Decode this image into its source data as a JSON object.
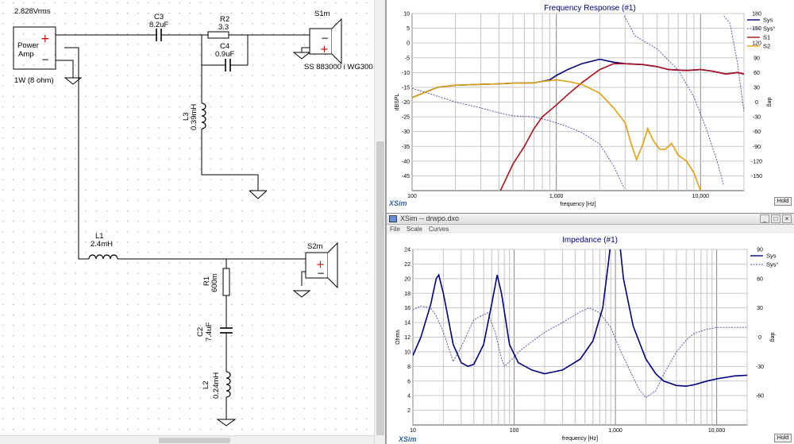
{
  "schematic": {
    "source_voltage": "2.828Vrms",
    "amp_label_line1": "Power",
    "amp_label_line2": "Amp",
    "amp_plus": "+",
    "amp_minus": "−",
    "amp_rating": "1W (8 ohm)",
    "c3_name": "C3",
    "c3_value": "8.2uF",
    "r2_name": "R2",
    "r2_value": "3.3",
    "c4_name": "C4",
    "c4_value": "0.9uF",
    "l3_name": "L3",
    "l3_value": "0.39mH",
    "s1_name": "S1m",
    "s1_model": "SS 883000 i WG300",
    "l1_name": "L1",
    "l1_value": "2.4mH",
    "s2_name": "S2m",
    "r1_name": "R1",
    "r1_value": "600m",
    "c2_name": "C2",
    "c2_value": "7.4uF",
    "l2_name": "L2",
    "l2_value": "0.24mH"
  },
  "frequency_response": {
    "title": "Frequency Response (#1)",
    "brand": "XSim",
    "hold_label": "Hold",
    "chart_data": {
      "type": "line",
      "title": "Frequency Response (#1)",
      "xlabel": "frequency [Hz]",
      "ylabel": "dBSPL",
      "y2label": "deg",
      "x_scale": "log",
      "xlim": [
        100,
        20000
      ],
      "ylim": [
        -50,
        10
      ],
      "y2lim": [
        -180,
        180
      ],
      "x_tick_labels": [
        "100",
        "1,000",
        "10,000"
      ],
      "x_ticks": [
        100,
        1000,
        10000
      ],
      "y_ticks": [
        10,
        5,
        0,
        -5,
        -10,
        -15,
        -20,
        -25,
        -30,
        -35,
        -40,
        -45
      ],
      "y2_ticks": [
        180,
        150,
        120,
        90,
        60,
        30,
        0,
        -30,
        -60,
        -90,
        -120,
        -150
      ],
      "legend": [
        "Sys",
        "Sys°",
        "S1",
        "S2"
      ],
      "legend_position": "right",
      "grid": true,
      "series": [
        {
          "name": "Sys",
          "color": "#000080",
          "style": "solid",
          "axis": "left",
          "points": [
            [
              100,
              -18.5
            ],
            [
              150,
              -15
            ],
            [
              200,
              -14.3
            ],
            [
              300,
              -14
            ],
            [
              400,
              -13.8
            ],
            [
              500,
              -13.6
            ],
            [
              700,
              -13.5
            ],
            [
              900,
              -12.5
            ],
            [
              1000,
              -11
            ],
            [
              1200,
              -9
            ],
            [
              1500,
              -7
            ],
            [
              2000,
              -5.5
            ],
            [
              2500,
              -6.5
            ],
            [
              3000,
              -7
            ],
            [
              4000,
              -7.3
            ],
            [
              5000,
              -8
            ],
            [
              6000,
              -9
            ],
            [
              8000,
              -9.3
            ],
            [
              10000,
              -9
            ],
            [
              12000,
              -9.5
            ],
            [
              15000,
              -10.5
            ],
            [
              18000,
              -10
            ],
            [
              20000,
              -10.5
            ]
          ]
        },
        {
          "name": "Sys°",
          "color": "#4a4a9a",
          "style": "dashed",
          "axis": "right",
          "points": [
            [
              100,
              28
            ],
            [
              150,
              12
            ],
            [
              200,
              0
            ],
            [
              300,
              -12
            ],
            [
              400,
              -22
            ],
            [
              500,
              -28
            ],
            [
              700,
              -30
            ],
            [
              900,
              -38
            ],
            [
              1200,
              -50
            ],
            [
              1500,
              -62
            ],
            [
              2000,
              -85
            ],
            [
              2500,
              -130
            ],
            [
              2950,
              -175
            ],
            [
              2960,
              175
            ],
            [
              3500,
              135
            ],
            [
              5000,
              108
            ],
            [
              7000,
              65
            ],
            [
              9000,
              10
            ],
            [
              11000,
              -55
            ],
            [
              13000,
              -120
            ],
            [
              14500,
              -170
            ],
            [
              14510,
              175
            ],
            [
              16000,
              160
            ],
            [
              18000,
              80
            ],
            [
              20000,
              -20
            ]
          ]
        },
        {
          "name": "S1",
          "color": "#aa1020",
          "style": "solid",
          "axis": "left",
          "points": [
            [
              410,
              -50
            ],
            [
              500,
              -41
            ],
            [
              600,
              -35
            ],
            [
              700,
              -29
            ],
            [
              800,
              -25
            ],
            [
              1000,
              -21
            ],
            [
              1200,
              -17.5
            ],
            [
              1500,
              -13.5
            ],
            [
              2000,
              -9
            ],
            [
              2500,
              -7
            ],
            [
              3000,
              -7
            ],
            [
              4000,
              -7.3
            ],
            [
              5000,
              -8
            ],
            [
              6000,
              -9
            ],
            [
              8000,
              -9.3
            ],
            [
              10000,
              -9
            ],
            [
              12000,
              -9.5
            ],
            [
              15000,
              -10.5
            ],
            [
              18000,
              -10
            ],
            [
              20000,
              -10.5
            ]
          ]
        },
        {
          "name": "S2",
          "color": "#e0a010",
          "style": "solid",
          "axis": "left",
          "points": [
            [
              100,
              -18.5
            ],
            [
              150,
              -15
            ],
            [
              200,
              -14.3
            ],
            [
              300,
              -14
            ],
            [
              400,
              -13.8
            ],
            [
              500,
              -13.6
            ],
            [
              700,
              -13.5
            ],
            [
              800,
              -13
            ],
            [
              1000,
              -12.5
            ],
            [
              1200,
              -13
            ],
            [
              1500,
              -14
            ],
            [
              2000,
              -17
            ],
            [
              2500,
              -22
            ],
            [
              3000,
              -27
            ],
            [
              3300,
              -34
            ],
            [
              3600,
              -39.5
            ],
            [
              4000,
              -34
            ],
            [
              4300,
              -29
            ],
            [
              4700,
              -33
            ],
            [
              5200,
              -36
            ],
            [
              5700,
              -36
            ],
            [
              6300,
              -34
            ],
            [
              7000,
              -38
            ],
            [
              8000,
              -40
            ],
            [
              9000,
              -44
            ],
            [
              10000,
              -50
            ]
          ]
        }
      ]
    }
  },
  "impedance": {
    "window_title": "XSim -- drwpo.dxo",
    "menu": [
      "File",
      "Scale",
      "Curves"
    ],
    "window_buttons": [
      "_",
      "□",
      "×"
    ],
    "title": "Impedance (#1)",
    "brand": "XSim",
    "hold_label": "Hold",
    "chart_data": {
      "type": "line",
      "title": "Impedance (#1)",
      "xlabel": "frequency [Hz]",
      "ylabel": "Ohms",
      "y2label": "deg",
      "x_scale": "log",
      "xlim": [
        10,
        20000
      ],
      "ylim": [
        0,
        24
      ],
      "y2lim": [
        -90,
        90
      ],
      "x_tick_labels": [
        "10",
        "100",
        "1,000",
        "10,000"
      ],
      "x_ticks": [
        10,
        100,
        1000,
        10000
      ],
      "y_ticks": [
        24,
        22,
        20,
        18,
        16,
        14,
        12,
        10,
        8,
        6,
        4,
        2
      ],
      "y2_ticks": [
        90,
        60,
        30,
        0,
        -30,
        -60
      ],
      "legend": [
        "Sys",
        "Sys°"
      ],
      "legend_position": "right",
      "grid": true,
      "series": [
        {
          "name": "Sys",
          "color": "#000080",
          "style": "solid",
          "axis": "left",
          "points": [
            [
              10,
              9.5
            ],
            [
              12,
              12
            ],
            [
              15,
              16.5
            ],
            [
              17,
              20
            ],
            [
              18,
              20.5
            ],
            [
              20,
              18
            ],
            [
              25,
              11
            ],
            [
              30,
              8.5
            ],
            [
              35,
              8
            ],
            [
              40,
              8.3
            ],
            [
              50,
              11
            ],
            [
              60,
              16.5
            ],
            [
              68,
              20.5
            ],
            [
              75,
              18
            ],
            [
              90,
              11
            ],
            [
              110,
              8.5
            ],
            [
              150,
              7.5
            ],
            [
              200,
              7
            ],
            [
              300,
              7.5
            ],
            [
              450,
              9
            ],
            [
              600,
              11.5
            ],
            [
              750,
              16
            ],
            [
              850,
              22
            ],
            [
              900,
              25
            ],
            [
              1000,
              30
            ],
            [
              1100,
              25
            ],
            [
              1200,
              20
            ],
            [
              1500,
              13.5
            ],
            [
              2000,
              9
            ],
            [
              2500,
              7
            ],
            [
              3000,
              6
            ],
            [
              4000,
              5.4
            ],
            [
              5000,
              5.3
            ],
            [
              6000,
              5.5
            ],
            [
              8000,
              6
            ],
            [
              10000,
              6.3
            ],
            [
              15000,
              6.7
            ],
            [
              20000,
              6.8
            ]
          ]
        },
        {
          "name": "Sys°",
          "color": "#4a4a9a",
          "style": "dashed",
          "axis": "right",
          "points": [
            [
              10,
              28
            ],
            [
              12,
              32
            ],
            [
              15,
              30
            ],
            [
              17,
              22
            ],
            [
              20,
              5
            ],
            [
              25,
              -25
            ],
            [
              30,
              -10
            ],
            [
              40,
              18
            ],
            [
              55,
              25
            ],
            [
              65,
              5
            ],
            [
              75,
              -22
            ],
            [
              80,
              -30
            ],
            [
              90,
              -25
            ],
            [
              120,
              -12
            ],
            [
              200,
              5
            ],
            [
              300,
              15
            ],
            [
              450,
              26
            ],
            [
              550,
              30
            ],
            [
              700,
              25
            ],
            [
              900,
              10
            ],
            [
              1100,
              -12
            ],
            [
              1400,
              -35
            ],
            [
              1700,
              -53
            ],
            [
              2000,
              -62
            ],
            [
              2500,
              -55
            ],
            [
              3000,
              -38
            ],
            [
              4000,
              -15
            ],
            [
              5000,
              -3
            ],
            [
              6000,
              4
            ],
            [
              8000,
              8
            ],
            [
              10000,
              10
            ],
            [
              15000,
              10
            ],
            [
              20000,
              10
            ]
          ]
        }
      ]
    }
  }
}
